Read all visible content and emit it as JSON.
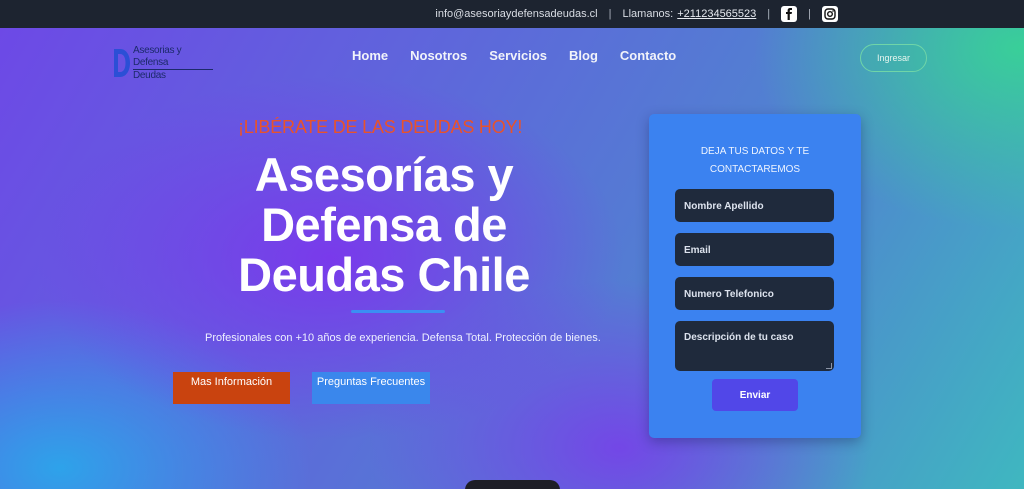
{
  "topbar": {
    "email": "info@asesoriaydefensadeudas.cl",
    "sep1": "|",
    "phone_label": "Llamanos:",
    "phone": "+211234565523",
    "sep2": "|",
    "sep3": "|",
    "icons": [
      "facebook-icon",
      "instagram-icon"
    ]
  },
  "logo": {
    "line1": "Asesorias y Defensa",
    "line2": "Deudas",
    "colors": {
      "mark": "#2b4fd6",
      "text": "#1c2a6b"
    }
  },
  "nav": {
    "items": [
      "Home",
      "Nosotros",
      "Servicios",
      "Blog",
      "Contacto"
    ],
    "login": "Ingresar"
  },
  "hero": {
    "tagline": "¡LIBÉRATE DE LAS DEUDAS HOY!",
    "headline": "Asesorías y Defensa de Deudas Chile",
    "subtext": "Profesionales con +10 años de experiencia. Defensa Total. Protección de bienes.",
    "btn_info": "Mas Información",
    "btn_faq": "Preguntas Frecuentes"
  },
  "form": {
    "title_line1": "DEJA TUS DATOS Y TE",
    "title_line2": "CONTACTAREMOS",
    "name_placeholder": "Nombre Apellido",
    "email_placeholder": "Email",
    "phone_placeholder": "Numero Telefonico",
    "desc_placeholder": "Descripción de tu caso",
    "submit": "Enviar"
  },
  "colors": {
    "tagline": "#e8532b",
    "btn_info": "#c9430f",
    "btn_faq": "#3a87ec",
    "form_bg": "#3b82f0",
    "submit_bg": "#5147e8",
    "topbar_bg": "#1d2430"
  }
}
